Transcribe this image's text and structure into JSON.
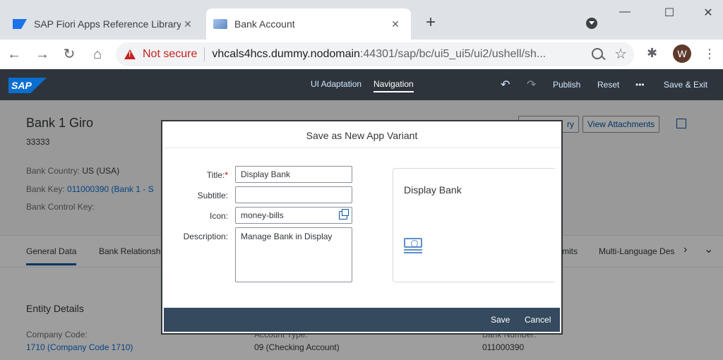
{
  "browser": {
    "tabs": [
      {
        "title": "SAP Fiori Apps Reference Library",
        "close": "✕"
      },
      {
        "title": "Bank Account",
        "close": "✕"
      }
    ],
    "new_tab": "+",
    "window_controls": {
      "minimize": "—",
      "maximize": "☐",
      "close": "✕"
    },
    "nav": {
      "back": "←",
      "forward": "→",
      "reload": "↻",
      "home": "⌂"
    },
    "address": {
      "security": "Not secure",
      "host": "vhcals4hcs.dummy.nodomain",
      "rest": ":44301/sap/bc/ui5_ui5/ui2/ushell/sh..."
    },
    "star": "☆",
    "extensions": "✱",
    "profile_initial": "W",
    "menu": "⋮"
  },
  "shell": {
    "logo": "SAP",
    "links": [
      "UI Adaptation",
      "Navigation"
    ],
    "undo": "↶",
    "redo": "↷",
    "publish": "Publish",
    "reset": "Reset",
    "more": "•••",
    "save_exit": "Save & Exit"
  },
  "objectpage": {
    "title": "Bank 1 Giro",
    "subtitle": "33333",
    "attributes": [
      {
        "label": "Bank Country:",
        "value": "US (USA)"
      },
      {
        "label": "Bank Key:",
        "value": "011000390 (Bank 1 - S"
      },
      {
        "label": "Bank Control Key:",
        "value": ""
      }
    ],
    "header_buttons": [
      "ry",
      "View Attachments"
    ],
    "tabs": [
      "General Data",
      "Bank Relationsh",
      "mits",
      "Multi-Language Des"
    ],
    "tab_more": "›",
    "tab_expand": "⌄",
    "section_title": "Entity Details",
    "fields": [
      {
        "label": "Company Code:",
        "value": "1710 (Company Code 1710)"
      },
      {
        "label": "Account Type:",
        "value": "09 (Checking Account)"
      },
      {
        "label": "Bank Number:",
        "value": "011000390"
      }
    ]
  },
  "dialog": {
    "title": "Save as New App Variant",
    "labels": {
      "title": "Title:",
      "subtitle": "Subtitle:",
      "icon": "Icon:",
      "description": "Description:"
    },
    "required_mark": "*",
    "values": {
      "title": "Display Bank",
      "subtitle": "",
      "icon": "money-bills",
      "description": "Manage Bank in Display"
    },
    "preview": {
      "title": "Display Bank",
      "icon": "money-bills-icon"
    },
    "buttons": {
      "save": "Save",
      "cancel": "Cancel"
    }
  },
  "colors": {
    "shell": "#2e343b",
    "footer": "#354a5f",
    "link": "#0a6ed1",
    "required": "#bb0000"
  }
}
